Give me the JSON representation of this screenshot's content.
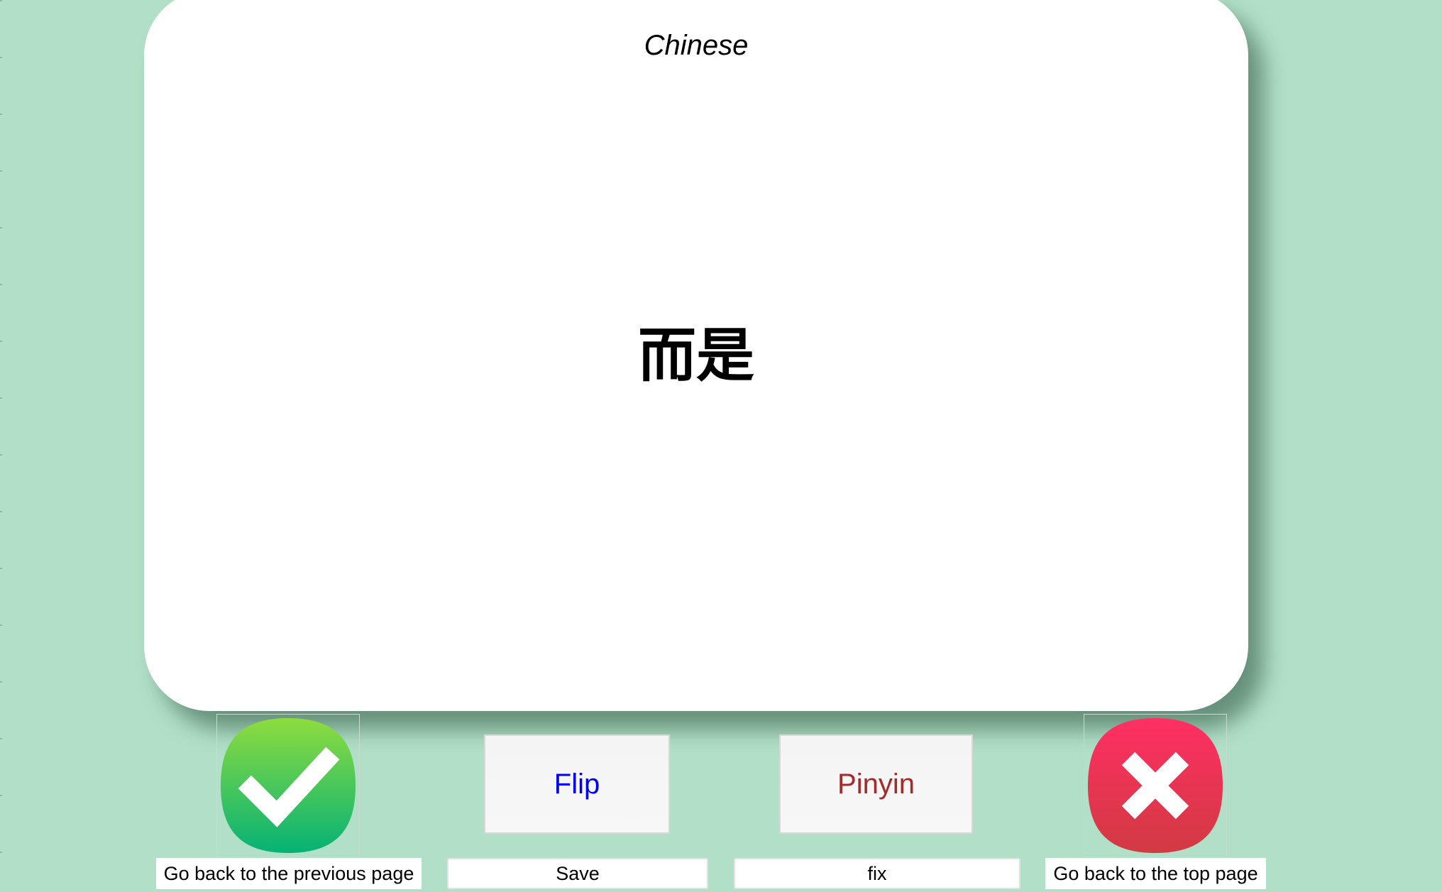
{
  "card": {
    "language_label": "Chinese",
    "word": "而是"
  },
  "buttons": {
    "correct_icon": "check-icon",
    "incorrect_icon": "close-icon",
    "flip_label": "Flip",
    "pinyin_label": "Pinyin"
  },
  "captions": {
    "previous": "Go back to the previous page",
    "save": "Save",
    "fix": "fix",
    "top": "Go back to the top page"
  },
  "colors": {
    "background": "#b2dfc8",
    "flip_text": "#0000ee",
    "pinyin_text": "#a52a2a",
    "check_top": "#8edc3e",
    "check_bottom": "#05b276",
    "close_top": "#ff2f63",
    "close_bottom": "#d13a43"
  }
}
